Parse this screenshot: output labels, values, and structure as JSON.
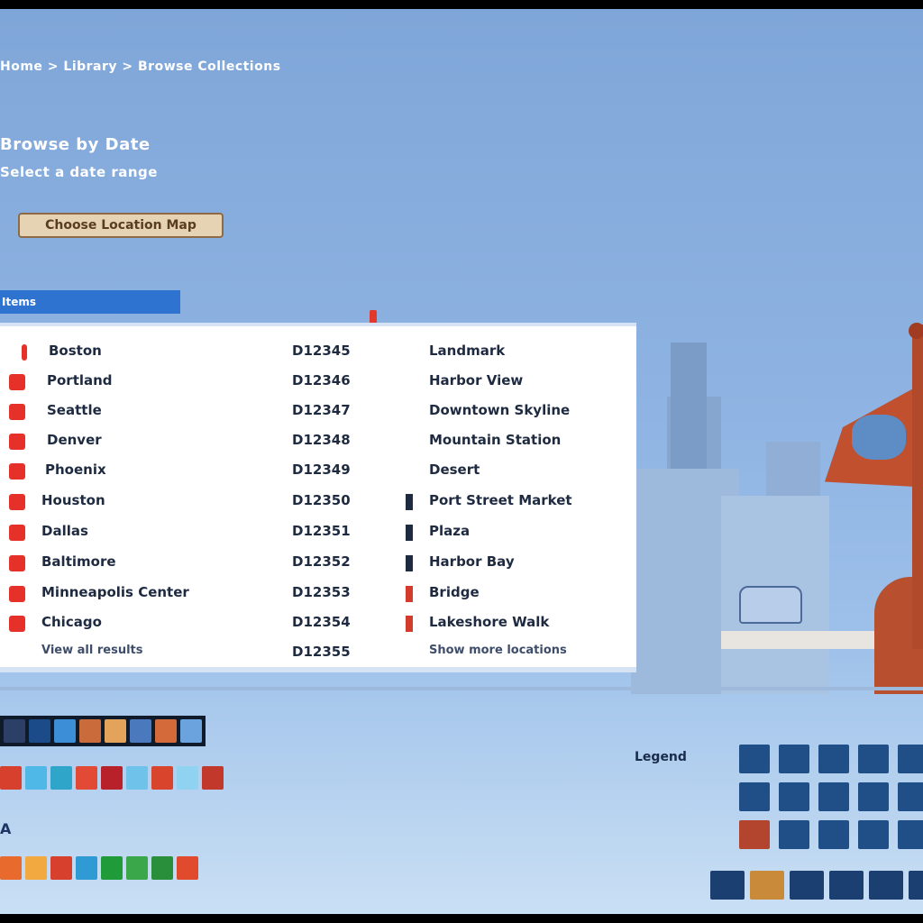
{
  "header": {
    "breadcrumb": "Home > Library > Browse Collections",
    "title": "Browse by Date",
    "subtitle": "Select a date range",
    "location_button": "Choose Location Map"
  },
  "list": {
    "tab_label": "Items",
    "rows": [
      {
        "name": "Boston",
        "code": "D12345",
        "desc": "Landmark"
      },
      {
        "name": "Portland",
        "code": "D12346",
        "desc": "Harbor View"
      },
      {
        "name": "Seattle",
        "code": "D12347",
        "desc": "Downtown Skyline"
      },
      {
        "name": "Denver",
        "code": "D12348",
        "desc": "Mountain Station"
      },
      {
        "name": "Phoenix",
        "code": "D12349",
        "desc": "Desert"
      },
      {
        "name": "Houston",
        "code": "D12350",
        "desc": "Port Street Market"
      },
      {
        "name": "Dallas",
        "code": "D12351",
        "desc": "Plaza"
      },
      {
        "name": "Baltimore",
        "code": "D12352",
        "desc": "Harbor Bay"
      },
      {
        "name": "Minneapolis Center",
        "code": "D12353",
        "desc": "Bridge"
      },
      {
        "name": "Chicago",
        "code": "D12354",
        "desc": "Lakeshore Walk"
      },
      {
        "name": "View all results",
        "code": "D12355",
        "desc": "Show more locations"
      }
    ]
  },
  "bottom": {
    "small_label": "A",
    "grid_label": "Legend"
  },
  "colors": {
    "accent_blue": "#2f73d1",
    "checkbox_red": "#e5312a",
    "grid_blue": "#1f4f86"
  },
  "icons": {
    "row_checkbox": "checkbox-icon",
    "row_flag": "flag-icon"
  }
}
